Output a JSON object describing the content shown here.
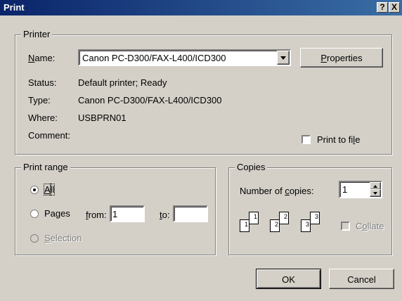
{
  "window": {
    "title": "Print",
    "help_label": "?",
    "close_label": "X"
  },
  "printer": {
    "group_label": "Printer",
    "name_label": "Name:",
    "name_value": "Canon PC-D300/FAX-L400/ICD300",
    "properties_label": "Properties",
    "status_label": "Status:",
    "status_value": "Default printer; Ready",
    "type_label": "Type:",
    "type_value": "Canon PC-D300/FAX-L400/ICD300",
    "where_label": "Where:",
    "where_value": "USBPRN01",
    "comment_label": "Comment:",
    "print_to_file_label": "Print to file"
  },
  "print_range": {
    "group_label": "Print range",
    "all_label": "All",
    "pages_label": "Pages",
    "from_label": "from:",
    "from_value": "1",
    "to_label": "to:",
    "to_value": "",
    "selection_label": "Selection",
    "selected": "all"
  },
  "copies": {
    "group_label": "Copies",
    "number_label": "Number of copies:",
    "number_value": "1",
    "collate_label": "Collate",
    "page_numbers": [
      "1",
      "1",
      "2",
      "2",
      "3",
      "3"
    ]
  },
  "buttons": {
    "ok_label": "OK",
    "cancel_label": "Cancel"
  }
}
